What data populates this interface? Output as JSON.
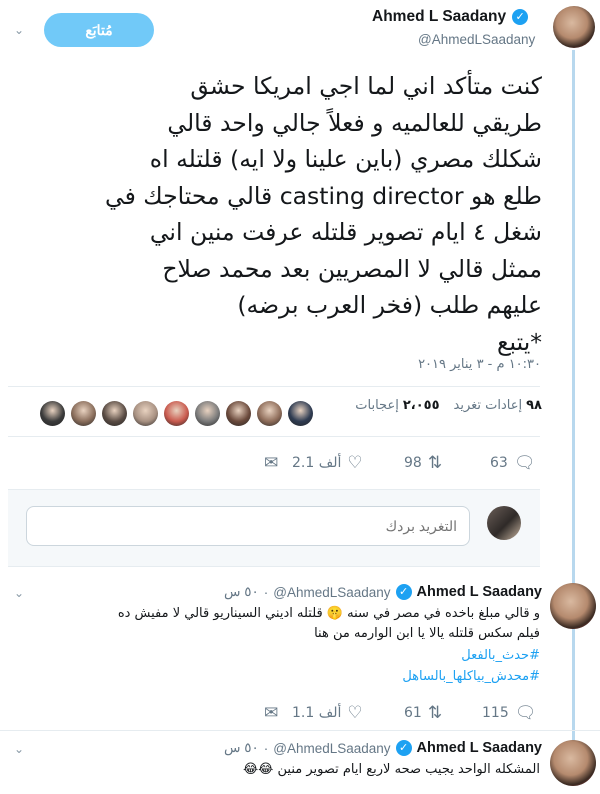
{
  "main_tweet": {
    "author_name": "Ahmed L Saadany",
    "author_handle": "@AhmedLSaadany",
    "follow_label": "مُتابَع",
    "text_lines": [
      "كنت متأكد اني لما اجي امريكا حشق",
      "طريقي للعالميه  و فعلاً جالي واحد قالي",
      "شكلك مصري (باين علينا ولا ايه) قلتله اه",
      "طلع هو casting director قالي محتاجك في",
      "شغل ٤ ايام تصوير  قلتله عرفت منين اني",
      "ممثل قالي لا المصريين بعد محمد صلاح",
      "عليهم طلب (فخر العرب برضه)",
      "*يتبع"
    ],
    "timestamp": "١٠:٣٠ م - ٣ يناير ٢٠١٩",
    "retweets_count": "٩٨",
    "retweets_label": "إعادات تغريد",
    "likes_count": "٢،٠٥٥",
    "likes_label": "إعجابات",
    "actions": {
      "reply_count": "63",
      "retweet_count": "98",
      "like_count": "2.1 ألف"
    },
    "liker_colors": [
      "#3b3b3b",
      "#8a6e5c",
      "#5a4c44",
      "#a89182",
      "#c95a4e",
      "#7b7b7b",
      "#6b4a3c",
      "#8f6d5a",
      "#2f3c52",
      "#b7a698",
      "#43362e",
      "#55636f"
    ]
  },
  "reply_composer": {
    "placeholder": "التغريد بردك"
  },
  "replies": [
    {
      "author_name": "Ahmed L Saadany",
      "author_handle": "@AhmedLSaadany",
      "time": "٥٠ س",
      "text_lines": [
        "و  قالي مبلغ باخده في مصر في سنه 🤫 قلتله اديني السيناريو قالي لا مفيش ده",
        "فيلم سكس   قلتله يالا يا ابن الوارمه من هنا"
      ],
      "hashtags": [
        "#حدث_بالفعل",
        "#محدش_بياكلها_بالساهل"
      ],
      "reply_count": "115",
      "retweet_count": "61",
      "like_count": "1.1 ألف"
    },
    {
      "author_name": "Ahmed L Saadany",
      "author_handle": "@AhmedLSaadany",
      "time": "٥٠ س",
      "text_lines": [
        "المشكله الواحد يجيب صحه لاربع ايام تصوير منين 😂😂"
      ]
    }
  ],
  "colors": {
    "accent": "#1da1f2",
    "follow_button": "#71c9f8",
    "thread_line": "#b8d8ee",
    "muted": "#657786",
    "divider": "#e6ecf0"
  },
  "icons": [
    "chevron-down-icon",
    "verified-badge-icon",
    "reply-icon",
    "retweet-icon",
    "like-icon",
    "direct-message-icon"
  ]
}
